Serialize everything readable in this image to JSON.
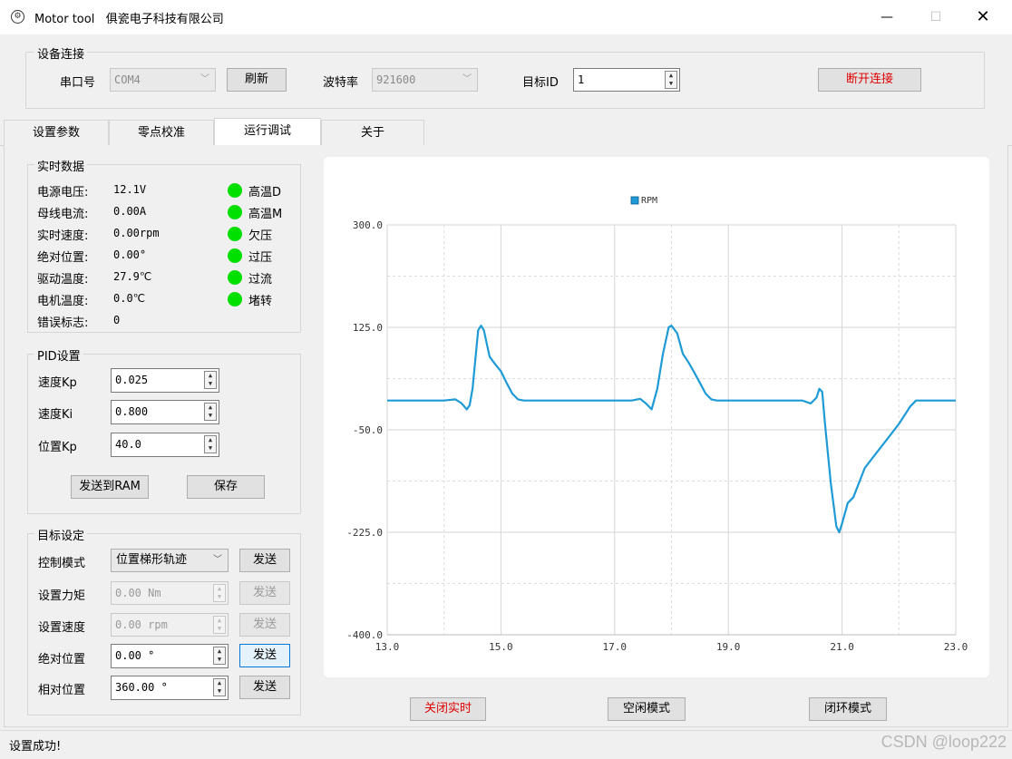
{
  "window": {
    "title": "Motor tool",
    "company": "俱瓷电子科技有限公司",
    "icon": "app-logo-icon"
  },
  "connection": {
    "group_label": "设备连接",
    "port_label": "串口号",
    "port_value": "COM4",
    "refresh_label": "刷新",
    "baud_label": "波特率",
    "baud_value": "921600",
    "target_id_label": "目标ID",
    "target_id_value": "1",
    "disconnect_label": "断开连接",
    "disconnect_color": "#e00000"
  },
  "tabs": [
    "设置参数",
    "零点校准",
    "运行调试",
    "关于"
  ],
  "realtime": {
    "group_label": "实时数据",
    "rows": [
      {
        "label": "电源电压:",
        "value": "12.1V"
      },
      {
        "label": "母线电流:",
        "value": "0.00A"
      },
      {
        "label": "实时速度:",
        "value": "0.00rpm"
      },
      {
        "label": "绝对位置:",
        "value": "0.00°"
      },
      {
        "label": "驱动温度:",
        "value": "27.9℃"
      },
      {
        "label": "电机温度:",
        "value": "0.0℃"
      },
      {
        "label": "错误标志:",
        "value": "0"
      }
    ],
    "indicators": [
      "高温D",
      "高温M",
      "欠压",
      "过压",
      "过流",
      "堵转"
    ],
    "indicator_color": "#00e000"
  },
  "pid": {
    "group_label": "PID设置",
    "rows": [
      {
        "label": "速度Kp",
        "value": "0.025"
      },
      {
        "label": "速度Ki",
        "value": "0.800"
      },
      {
        "label": "位置Kp",
        "value": "40.0"
      }
    ],
    "send_ram_label": "发送到RAM",
    "save_label": "保存"
  },
  "target": {
    "group_label": "目标设定",
    "mode_label": "控制模式",
    "mode_value": "位置梯形轨迹",
    "torque_label": "设置力矩",
    "torque_value": "0.00 Nm",
    "speed_label": "设置速度",
    "speed_value": "0.00 rpm",
    "abs_label": "绝对位置",
    "abs_value": "0.00 °",
    "rel_label": "相对位置",
    "rel_value": "360.00 °",
    "send_label": "发送"
  },
  "bottom_buttons": {
    "close_realtime": "关闭实时",
    "close_realtime_color": "#e00000",
    "idle_mode": "空闲模式",
    "closed_loop": "闭环模式"
  },
  "status": {
    "text": "设置成功!",
    "watermark": "CSDN @loop222"
  },
  "chart_data": {
    "type": "line",
    "legend": "top-center",
    "series": [
      {
        "name": "RPM",
        "color": "#1e9ad6",
        "points": [
          [
            13.0,
            0
          ],
          [
            14.0,
            0
          ],
          [
            14.2,
            2
          ],
          [
            14.3,
            -4
          ],
          [
            14.4,
            -15
          ],
          [
            14.45,
            -8
          ],
          [
            14.5,
            20
          ],
          [
            14.55,
            70
          ],
          [
            14.6,
            120
          ],
          [
            14.65,
            128
          ],
          [
            14.7,
            120
          ],
          [
            14.8,
            75
          ],
          [
            14.9,
            62
          ],
          [
            15.0,
            50
          ],
          [
            15.1,
            30
          ],
          [
            15.2,
            12
          ],
          [
            15.3,
            2
          ],
          [
            15.4,
            0
          ],
          [
            17.0,
            0
          ],
          [
            17.3,
            0
          ],
          [
            17.45,
            3
          ],
          [
            17.55,
            -5
          ],
          [
            17.65,
            -15
          ],
          [
            17.75,
            20
          ],
          [
            17.85,
            80
          ],
          [
            17.95,
            125
          ],
          [
            18.0,
            128
          ],
          [
            18.1,
            115
          ],
          [
            18.2,
            80
          ],
          [
            18.3,
            65
          ],
          [
            18.4,
            48
          ],
          [
            18.5,
            30
          ],
          [
            18.6,
            12
          ],
          [
            18.7,
            2
          ],
          [
            18.8,
            0
          ],
          [
            20.0,
            0
          ],
          [
            20.3,
            0
          ],
          [
            20.45,
            -5
          ],
          [
            20.55,
            5
          ],
          [
            20.6,
            20
          ],
          [
            20.65,
            15
          ],
          [
            20.7,
            -40
          ],
          [
            20.8,
            -140
          ],
          [
            20.9,
            -215
          ],
          [
            20.95,
            -225
          ],
          [
            21.0,
            -210
          ],
          [
            21.1,
            -175
          ],
          [
            21.2,
            -165
          ],
          [
            21.3,
            -140
          ],
          [
            21.4,
            -115
          ],
          [
            21.6,
            -90
          ],
          [
            21.8,
            -65
          ],
          [
            22.0,
            -40
          ],
          [
            22.2,
            -10
          ],
          [
            22.3,
            0
          ],
          [
            23.0,
            0
          ]
        ]
      }
    ],
    "x_ticks": [
      "13.0",
      "15.0",
      "17.0",
      "19.0",
      "21.0",
      "23.0"
    ],
    "y_ticks": [
      "300.0",
      "125.0",
      "-50.0",
      "-225.0",
      "-400.0"
    ],
    "xlim": [
      13.0,
      23.0
    ],
    "ylim": [
      -400,
      300
    ],
    "grid": true
  }
}
